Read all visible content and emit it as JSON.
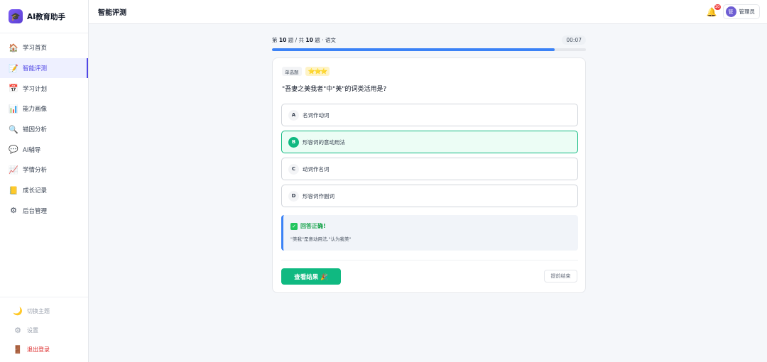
{
  "brand": {
    "name": "AI教育助手",
    "logo_icon": "🎓"
  },
  "sidebar": {
    "items": [
      {
        "label": "学习首页",
        "icon": "🏠"
      },
      {
        "label": "智能评测",
        "icon": "📝"
      },
      {
        "label": "学习计划",
        "icon": "📅"
      },
      {
        "label": "能力画像",
        "icon": "📊"
      },
      {
        "label": "错因分析",
        "icon": "🔍"
      },
      {
        "label": "AI辅导",
        "icon": "💬"
      },
      {
        "label": "学情分析",
        "icon": "📈"
      },
      {
        "label": "成长记录",
        "icon": "📒"
      },
      {
        "label": "后台管理",
        "icon": "⚙"
      }
    ],
    "active_index": 1,
    "bottom": [
      {
        "label": "切换主题",
        "icon": "🌙"
      },
      {
        "label": "设置",
        "icon": "⚙"
      },
      {
        "label": "退出登录",
        "icon": "🚪"
      }
    ]
  },
  "header": {
    "title": "智能评测",
    "notification_count": "10",
    "user": {
      "avatar_text": "管",
      "name": "管理员"
    }
  },
  "quiz": {
    "progress_prefix": "第",
    "current": "10",
    "progress_mid": "题 / 共",
    "total": "10",
    "progress_suffix": "题 · 语文",
    "timer": "00:07",
    "progress_fraction": 0.9,
    "type_tag": "单选题",
    "difficulty_stars": "⭐⭐⭐",
    "question": "\"吾妻之美我者\"中\"美\"的词类活用是?",
    "options": [
      {
        "letter": "A",
        "text": "名词作动词"
      },
      {
        "letter": "B",
        "text": "形容词的意动用法"
      },
      {
        "letter": "C",
        "text": "动词作名词"
      },
      {
        "letter": "D",
        "text": "形容词作副词"
      }
    ],
    "correct_index": 1,
    "feedback": {
      "title": "回答正确!",
      "check_icon": "✓",
      "explanation": "\"美我\"是意动用法,\"认为我美\""
    },
    "result_button": "查看结果 🎉",
    "end_button": "提前结束"
  },
  "colors": {
    "accent": "#4f46e5",
    "correct": "#10b981",
    "progress": "#3b82f6"
  }
}
